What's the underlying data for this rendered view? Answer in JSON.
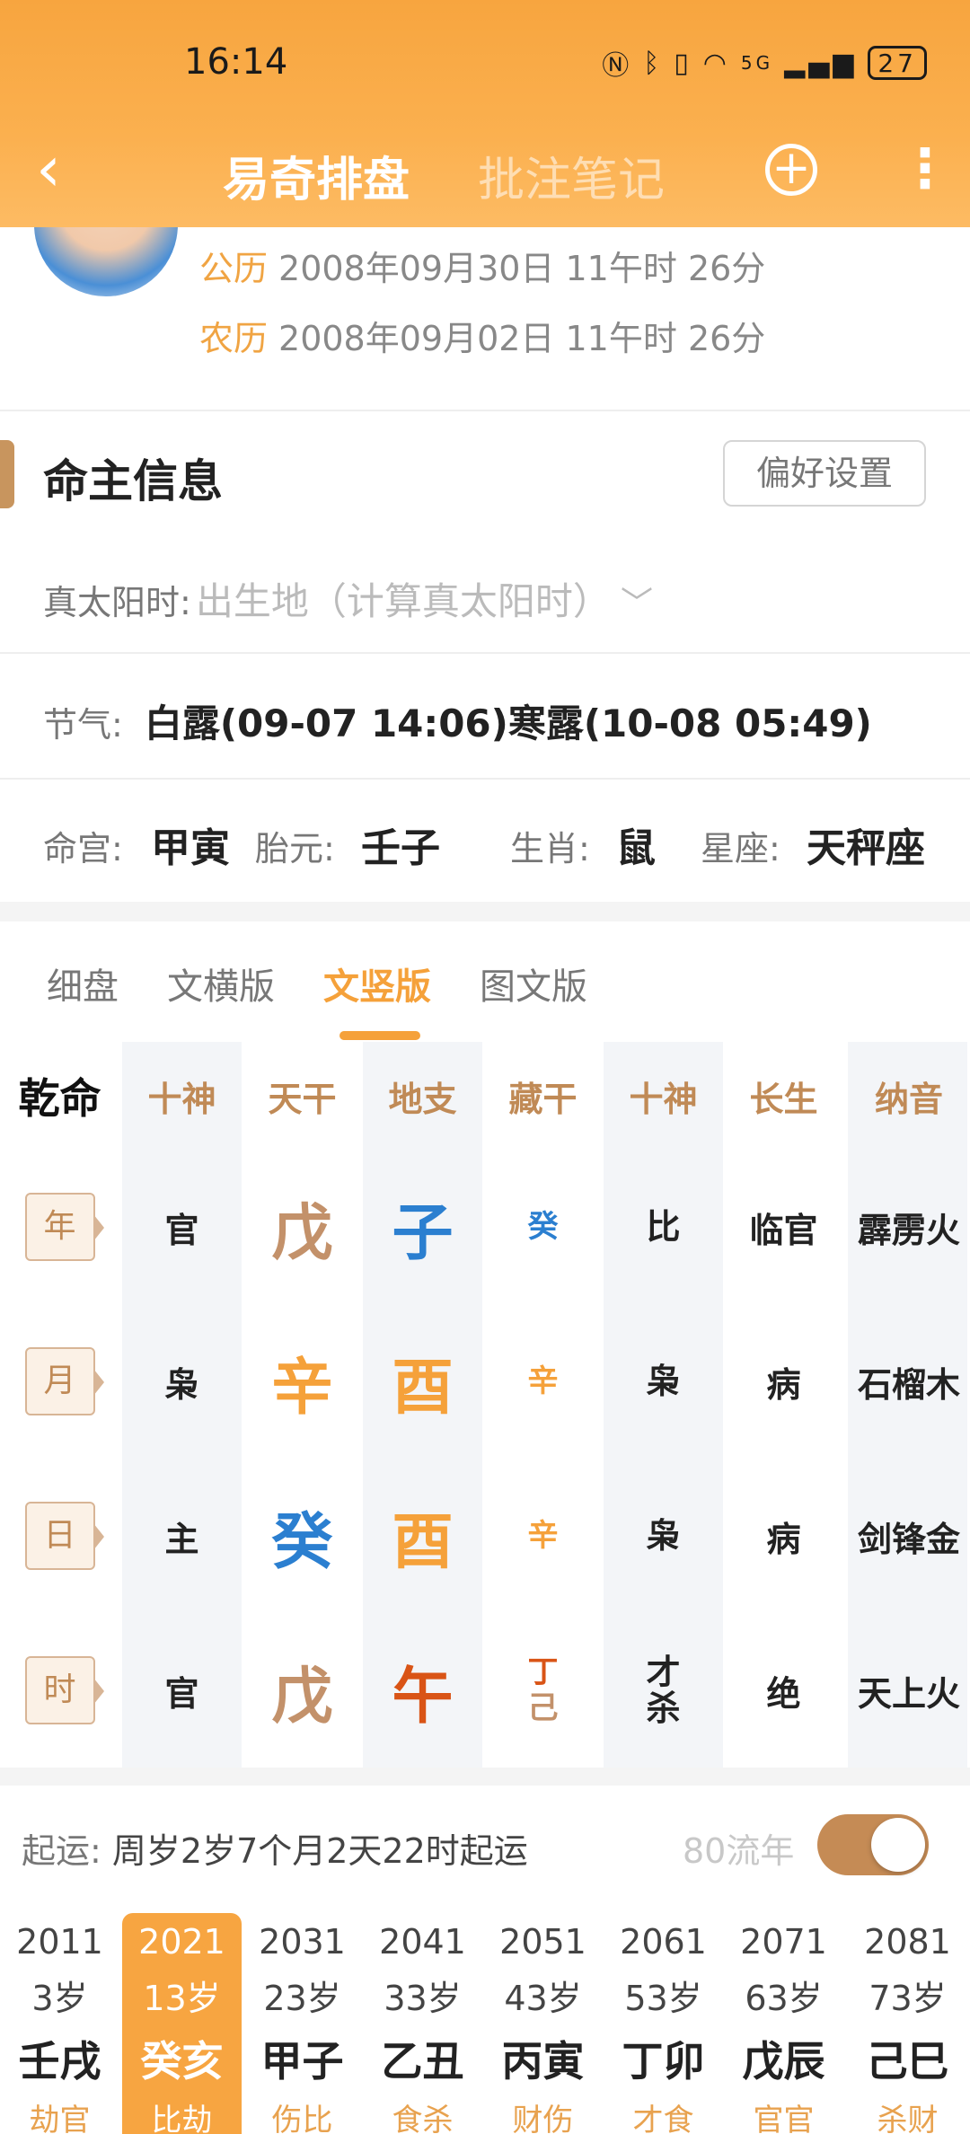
{
  "status_bar": {
    "time": "16:14",
    "network": "5G",
    "battery": "27"
  },
  "nav": {
    "back": "‹",
    "title": "易奇排盘",
    "notes_tab": "批注笔记",
    "add": "+",
    "more": "⋮"
  },
  "profile": {
    "solar_label": "公历",
    "solar_value": "2008年09月30日 11午时 26分",
    "lunar_label": "农历",
    "lunar_value": "2008年09月02日 11午时 26分"
  },
  "info": {
    "title": "命主信息",
    "pref_button": "偏好设置",
    "solar_time_label": "真太阳时:",
    "solar_time_placeholder": "出生地（计算真太阳时）",
    "jieqi_label": "节气:",
    "jieqi_value": "白露(09-07 14:06)寒露(10-08 05:49)",
    "minggong_label": "命宫:",
    "minggong_value": "甲寅",
    "taiyuan_label": "胎元:",
    "taiyuan_value": "壬子",
    "shengxiao_label": "生肖:",
    "shengxiao_value": "鼠",
    "xingzuo_label": "星座:",
    "xingzuo_value": "天秤座"
  },
  "view_tabs": [
    "细盘",
    "文横版",
    "文竖版",
    "图文版"
  ],
  "active_view": "文竖版",
  "table": {
    "corner": "乾命",
    "headers": [
      "十神",
      "天干",
      "地支",
      "藏干",
      "十神",
      "长生",
      "纳音"
    ],
    "rows": [
      {
        "pillar": "年",
        "shishen": "官",
        "tiangan": "戊",
        "dizhi": "子",
        "canggan": [
          "癸"
        ],
        "shishen2": [
          "比"
        ],
        "changsheng": "临官",
        "nayin": "霹雳火"
      },
      {
        "pillar": "月",
        "shishen": "枭",
        "tiangan": "辛",
        "dizhi": "酉",
        "canggan": [
          "辛"
        ],
        "shishen2": [
          "枭"
        ],
        "changsheng": "病",
        "nayin": "石榴木"
      },
      {
        "pillar": "日",
        "shishen": "主",
        "tiangan": "癸",
        "dizhi": "酉",
        "canggan": [
          "辛"
        ],
        "shishen2": [
          "枭"
        ],
        "changsheng": "病",
        "nayin": "剑锋金"
      },
      {
        "pillar": "时",
        "shishen": "官",
        "tiangan": "戊",
        "dizhi": "午",
        "canggan": [
          "丁",
          "己"
        ],
        "shishen2": [
          "才",
          "杀"
        ],
        "changsheng": "绝",
        "nayin": "天上火"
      }
    ],
    "colors": {
      "earth": "#c3916a",
      "metal": "#f5a13a",
      "water": "#2b7fd0",
      "fire": "#d95416",
      "dark": "#222222"
    },
    "row_colors": [
      {
        "tiangan": "earth",
        "dizhi": "water",
        "canggan": [
          "water"
        ]
      },
      {
        "tiangan": "metal",
        "dizhi": "metal",
        "canggan": [
          "metal"
        ]
      },
      {
        "tiangan": "water",
        "dizhi": "metal",
        "canggan": [
          "metal"
        ]
      },
      {
        "tiangan": "earth",
        "dizhi": "fire",
        "canggan": [
          "fire",
          "earth"
        ]
      }
    ]
  },
  "qiyun": {
    "label": "起运:",
    "value": "周岁2岁7个月2天22时起运",
    "liunian_label": "80流年",
    "liunian_on": true
  },
  "dayun": [
    {
      "year": "2011",
      "age": "3岁",
      "ganzhi": "壬戌",
      "tag": "劫官",
      "selected": false
    },
    {
      "year": "2021",
      "age": "13岁",
      "ganzhi": "癸亥",
      "tag": "比劫",
      "selected": true
    },
    {
      "year": "2031",
      "age": "23岁",
      "ganzhi": "甲子",
      "tag": "伤比",
      "selected": false
    },
    {
      "year": "2041",
      "age": "33岁",
      "ganzhi": "乙丑",
      "tag": "食杀",
      "selected": false
    },
    {
      "year": "2051",
      "age": "43岁",
      "ganzhi": "丙寅",
      "tag": "财伤",
      "selected": false
    },
    {
      "year": "2061",
      "age": "53岁",
      "ganzhi": "丁卯",
      "tag": "才食",
      "selected": false
    },
    {
      "year": "2071",
      "age": "63岁",
      "ganzhi": "戊辰",
      "tag": "官官",
      "selected": false
    },
    {
      "year": "2081",
      "age": "73岁",
      "ganzhi": "己巳",
      "tag": "杀财",
      "selected": false
    }
  ]
}
